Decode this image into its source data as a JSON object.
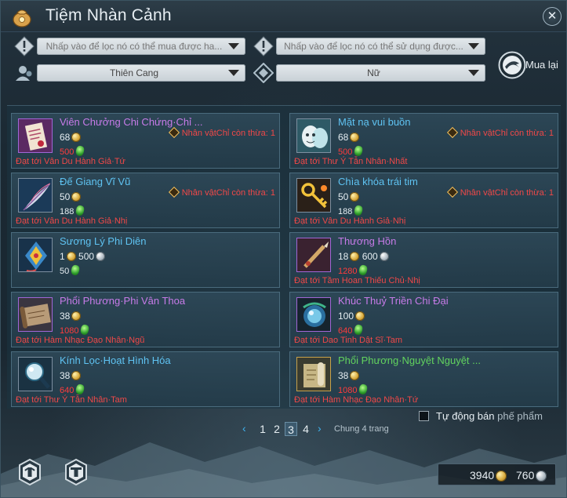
{
  "window": {
    "title": "Tiệm Nhàn Cảnh",
    "close_label": "✕"
  },
  "filters": {
    "buyable_placeholder": "Nhấp vào để lọc nó có thể mua được ha...",
    "usable_placeholder": "Nhấp vào để lọc nó có thể sử dụng được...",
    "faction_value": "Thiên Cang",
    "gender_value": "Nữ"
  },
  "buyback_label": "Mua lại",
  "items": [
    {
      "name": "Viên Chưởng Chi Chứng·Chỉ ...",
      "name_color": "purple",
      "price_gold": "68",
      "price_silver": "",
      "sub_value": "500",
      "sub_color": "red",
      "requirement": "Đạt tới Vân Du Hành Giả·Tứ",
      "stock_text": "Nhân vậtChỉ còn thừa: 1",
      "thumb": "scroll-paper"
    },
    {
      "name": "Mặt nạ vui buồn",
      "name_color": "blue",
      "price_gold": "68",
      "price_silver": "",
      "sub_value": "500",
      "sub_color": "red",
      "requirement": "Đạt tới Thư Ý Tẫn Nhân·Nhất",
      "stock_text": "Nhân vậtChỉ còn thừa: 1",
      "thumb": "mask"
    },
    {
      "name": "Đế Giang Vĩ Vũ",
      "name_color": "blue",
      "price_gold": "50",
      "price_silver": "",
      "sub_value": "188",
      "sub_color": "white",
      "requirement": "Đạt tới Vân Du Hành Giả·Nhị",
      "stock_text": "Nhân vậtChỉ còn thừa: 1",
      "thumb": "feather"
    },
    {
      "name": "Chìa khóa trái tim",
      "name_color": "blue",
      "price_gold": "50",
      "price_silver": "",
      "sub_value": "188",
      "sub_color": "white",
      "requirement": "Đạt tới Vân Du Hành Giả·Nhị",
      "stock_text": "Nhân vậtChỉ còn thừa: 1",
      "thumb": "key"
    },
    {
      "name": "Sương Lý Phi Diên",
      "name_color": "blue",
      "price_gold": "1",
      "price_silver": "500",
      "sub_value": "50",
      "sub_color": "white",
      "requirement": "",
      "stock_text": "",
      "thumb": "kite"
    },
    {
      "name": "Thương Hồn",
      "name_color": "purple",
      "price_gold": "18",
      "price_silver": "600",
      "sub_value": "1280",
      "sub_color": "red",
      "requirement": "Đạt tới Tầm Hoan Thiếu Chủ·Nhị",
      "stock_text": "",
      "thumb": "spear"
    },
    {
      "name": "Phổi Phương·Phi Vân Thoa",
      "name_color": "purple",
      "price_gold": "38",
      "price_silver": "",
      "sub_value": "1080",
      "sub_color": "red",
      "requirement": "Đạt tới Hàm Nhạc Đạo Nhân·Ngũ",
      "stock_text": "",
      "thumb": "scroll-brown"
    },
    {
      "name": "Khúc Thuỷ Triền Chi Đại",
      "name_color": "purple",
      "price_gold": "100",
      "price_silver": "",
      "sub_value": "640",
      "sub_color": "red",
      "requirement": "Đạt tới Dao Tinh Dật Sĩ·Tam",
      "stock_text": "",
      "thumb": "orb"
    },
    {
      "name": "Kính Lọc·Hoạt Hình Hóa",
      "name_color": "blue",
      "price_gold": "38",
      "price_silver": "",
      "sub_value": "640",
      "sub_color": "red",
      "requirement": "Đạt tới Thư Ý Tẫn Nhân·Tam",
      "stock_text": "",
      "thumb": "magnifier"
    },
    {
      "name": "Phổi Phương·Nguyệt Nguyệt ...",
      "name_color": "green",
      "price_gold": "38",
      "price_silver": "",
      "sub_value": "1080",
      "sub_color": "red",
      "requirement": "Đạt tới Hàm Nhạc Đạo Nhân·Tứ",
      "stock_text": "",
      "thumb": "scroll-gold"
    }
  ],
  "auto_sell": {
    "label": "Tự động bán",
    "suffix": "phế phẩm",
    "checked": false
  },
  "pagination": {
    "pages": [
      "1",
      "2",
      "3",
      "4"
    ],
    "current": "3",
    "total_text": "Chung 4 trang",
    "prev": "‹",
    "next": "›"
  },
  "wallet": {
    "gold": "3940",
    "silver": "760"
  },
  "colors": {
    "purple": "#c77be8",
    "blue": "#5fc3f2",
    "green": "#62d35e",
    "red": "#ff3c3c",
    "accent": "#3fb4f0"
  }
}
